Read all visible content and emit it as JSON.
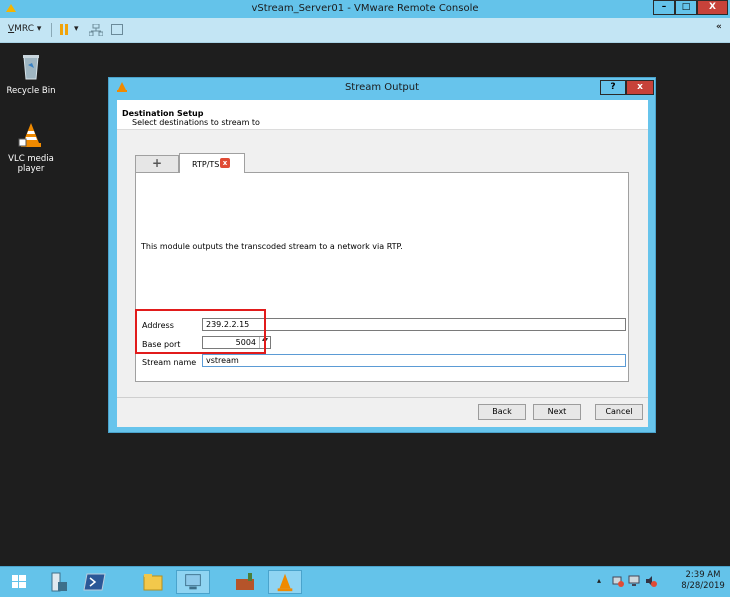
{
  "window": {
    "title": "vStream_Server01 - VMware Remote Console",
    "minimize_glyph": "–",
    "maximize_glyph": "□",
    "close_glyph": "X"
  },
  "toolbar": {
    "menu_prefix": "V",
    "menu_rest": "MRC",
    "menu_caret": "▾",
    "pause_caret": "▾",
    "collapse_glyph": "«"
  },
  "desktop": {
    "icons": [
      {
        "label": "Recycle Bin",
        "icon": "recycle-bin-icon"
      },
      {
        "label": "VLC media player",
        "icon": "vlc-cone-icon"
      }
    ]
  },
  "dialog": {
    "title": "Stream Output",
    "help_glyph": "?",
    "close_glyph": "x",
    "setup_title": "Destination Setup",
    "setup_subtitle": "Select destinations to stream to",
    "tabs": [
      {
        "label": "+",
        "icon": "add-tab-icon"
      },
      {
        "label": "RTP/TS",
        "close_glyph": "x"
      }
    ],
    "module_description": "This module outputs the transcoded stream to a network via RTP.",
    "form": {
      "address_label": "Address",
      "address_value": "239.2.2.15",
      "base_port_label": "Base port",
      "base_port_value": "5004",
      "spin_glyph": "▴▾",
      "stream_name_label": "Stream name",
      "stream_name_value": "vstream"
    },
    "buttons": {
      "back": "Back",
      "next": "Next",
      "cancel": "Cancel"
    },
    "highlight_color": "#e11b1b"
  },
  "taskbar": {
    "apps": [
      "start-button",
      "server-manager",
      "powershell",
      "file-explorer",
      "control-panel",
      "toolbox",
      "vlc"
    ],
    "tray_caret": "▴",
    "time": "2:39 AM",
    "date": "8/28/2019"
  },
  "colors": {
    "accent": "#64c3ea",
    "desktop": "#1e1e1e",
    "close": "#c7423a"
  }
}
